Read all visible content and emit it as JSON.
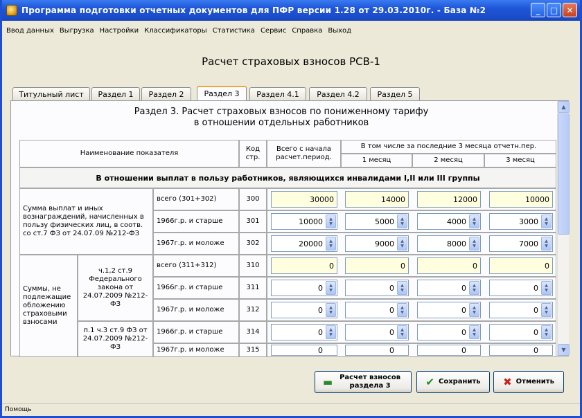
{
  "window": {
    "title": "Программа подготовки отчетных документов для ПФР версии 1.28 от 29.03.2010г. - База №2",
    "minimize": "_",
    "maximize": "□",
    "close": "✕"
  },
  "menu": [
    "Ввод данных",
    "Выгрузка",
    "Настройки",
    "Классификаторы",
    "Статистика",
    "Сервис",
    "Справка",
    "Выход"
  ],
  "form": {
    "title": "Расчет страховых взносов РСВ-1"
  },
  "tabs": [
    {
      "label": "Титульный лист",
      "active": false
    },
    {
      "label": "Раздел 1",
      "active": false
    },
    {
      "label": "Раздел 2",
      "active": false
    },
    {
      "label": "Раздел 3",
      "active": true
    },
    {
      "label": "Раздел 4.1",
      "active": false
    },
    {
      "label": "Раздел 4.2",
      "active": false
    },
    {
      "label": "Раздел 5",
      "active": false
    }
  ],
  "section": {
    "title_line1": "Раздел 3. Расчет страховых взносов по пониженному тарифу",
    "title_line2": "в отношении отдельных работников"
  },
  "table": {
    "header": {
      "name": "Наименование показателя",
      "code": "Код стр.",
      "total": "Всего с начала расчет.период.",
      "last3": "В том числе за последние 3 месяца отчетн.пер.",
      "m1": "1 месяц",
      "m2": "2 месяц",
      "m3": "3 месяц"
    },
    "band": "В отношении выплат в пользу работников, являющихся инвалидами I,II или III группы",
    "group1_label": "Сумма выплат и иных вознаграждений, начисленных в пользу физических лиц, в соотв. со ст.7 ФЗ от 24.07.09 №212-ФЗ",
    "group2_label": "Суммы, не подлежащие обложению страховыми взносами",
    "sub1_label": "ч.1,2 ст.9 Федерального закона от 24.07.2009 №212-ФЗ",
    "sub2_label": "п.1 ч.3 ст.9 ФЗ от 24.07.2009 №212-ФЗ",
    "rows": [
      {
        "desc": "всего (301+302)",
        "code": "300",
        "total": "30000",
        "m1": "14000",
        "m2": "12000",
        "m3": "10000",
        "computed": true
      },
      {
        "desc": "1966г.р. и старше",
        "code": "301",
        "total": "10000",
        "m1": "5000",
        "m2": "4000",
        "m3": "3000",
        "computed": false
      },
      {
        "desc": "1967г.р. и моложе",
        "code": "302",
        "total": "20000",
        "m1": "9000",
        "m2": "8000",
        "m3": "7000",
        "computed": false
      },
      {
        "desc": "всего (311+312)",
        "code": "310",
        "total": "0",
        "m1": "0",
        "m2": "0",
        "m3": "0",
        "computed": true
      },
      {
        "desc": "1966г.р. и старше",
        "code": "311",
        "total": "0",
        "m1": "0",
        "m2": "0",
        "m3": "0",
        "computed": false
      },
      {
        "desc": "1967г.р. и моложе",
        "code": "312",
        "total": "0",
        "m1": "0",
        "m2": "0",
        "m3": "0",
        "computed": false
      },
      {
        "desc": "1966г.р. и старше",
        "code": "314",
        "total": "0",
        "m1": "0",
        "m2": "0",
        "m3": "0",
        "computed": false
      },
      {
        "desc": "1967г.р. и моложе",
        "code": "315",
        "total": "0",
        "m1": "0",
        "m2": "0",
        "m3": "0",
        "computed": false
      }
    ]
  },
  "buttons": {
    "calc": "Расчет взносов раздела 3",
    "save": "Сохранить",
    "cancel": "Отменить"
  },
  "icons": {
    "app": "app-icon",
    "calc": "calculator-icon",
    "save": "checkmark-icon",
    "cancel": "cross-icon"
  },
  "colors": {
    "titlebar": "#1e56d8",
    "computed_field": "#ffffe0",
    "save_check": "#1e8a1e",
    "cancel_cross": "#c81e1e"
  },
  "status": {
    "text": "Помощь"
  }
}
